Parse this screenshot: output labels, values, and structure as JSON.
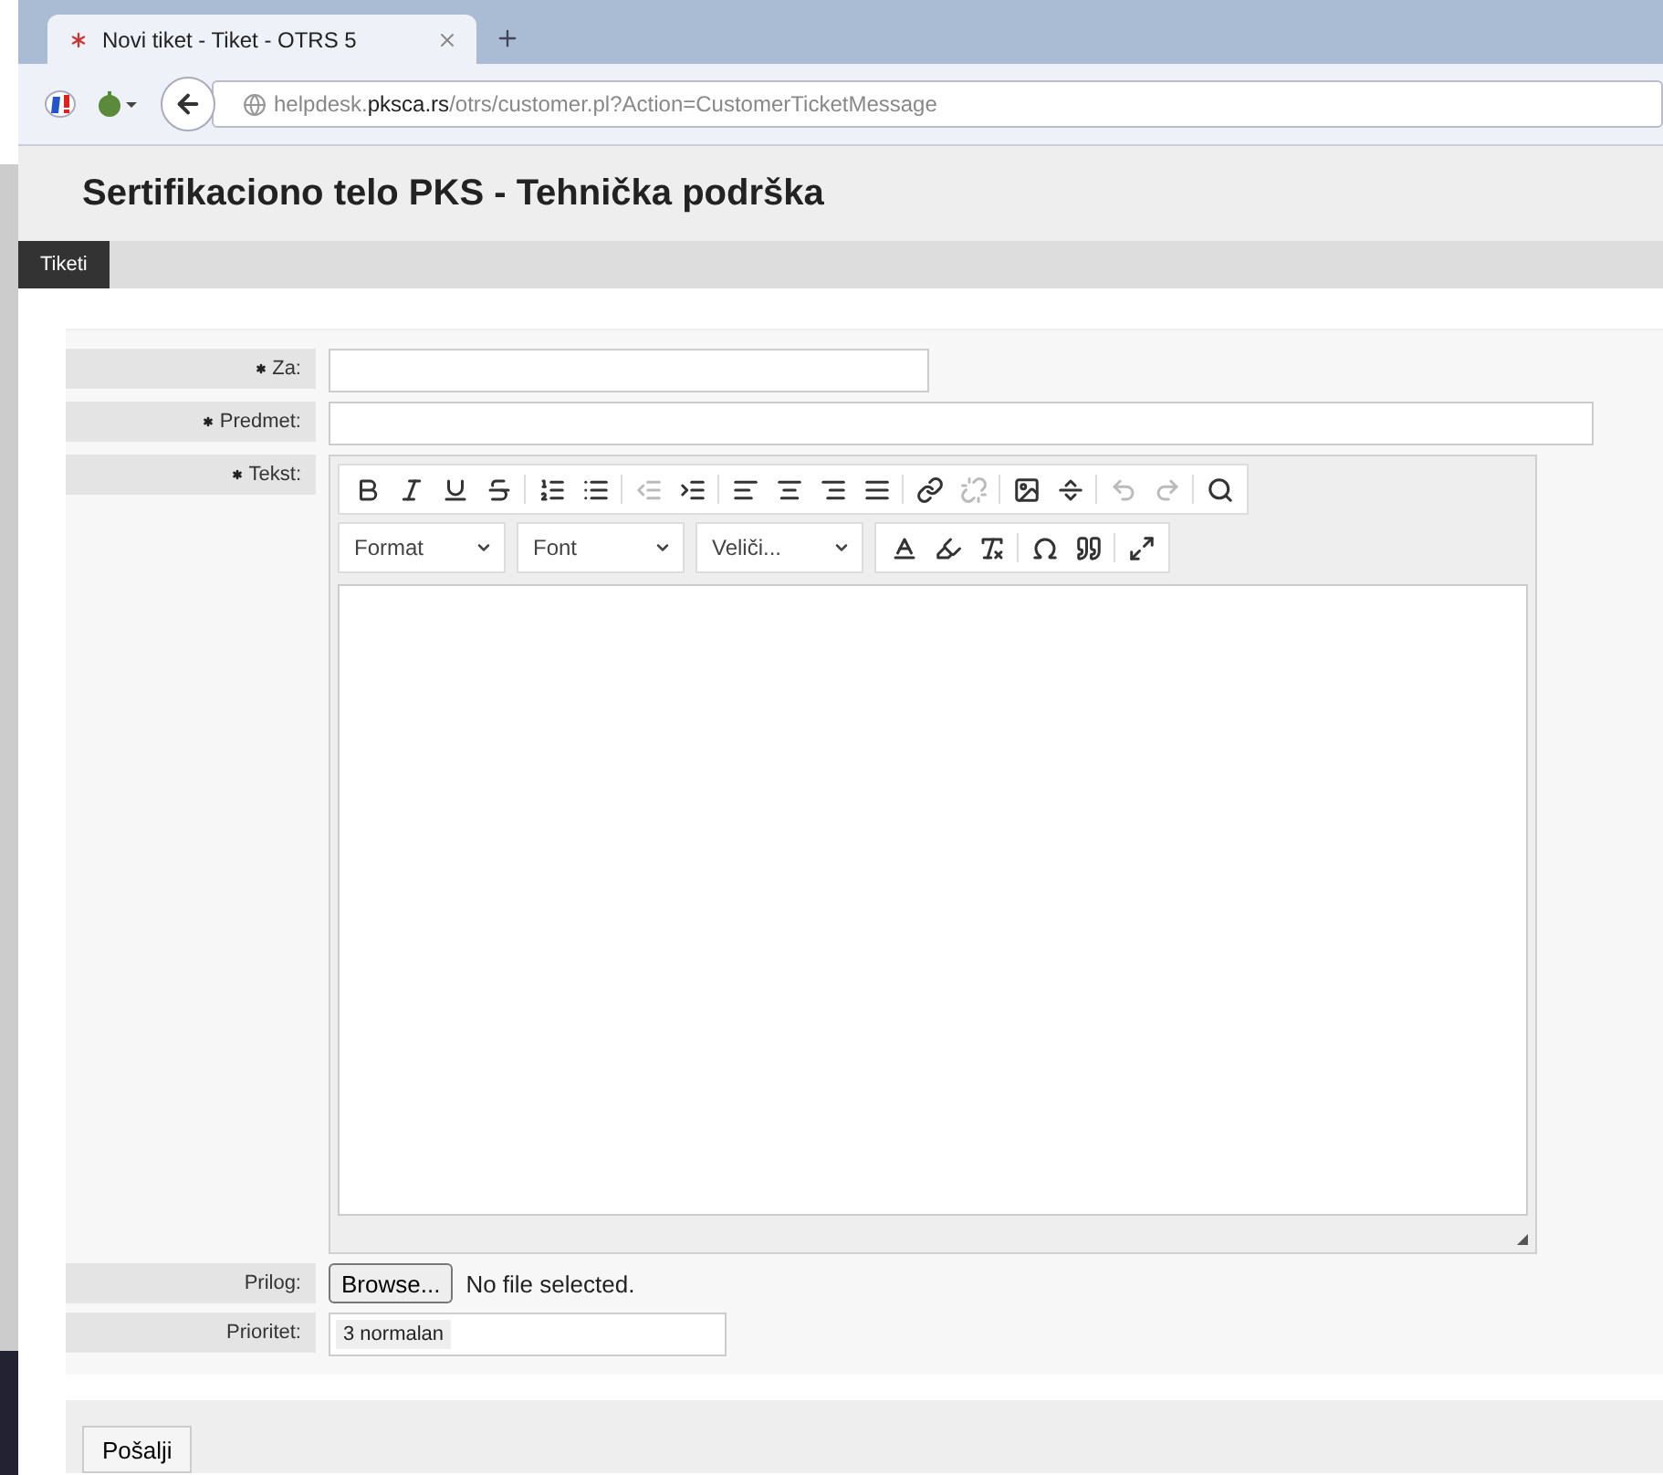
{
  "browser": {
    "tab_title": "Novi tiket - Tiket - OTRS 5",
    "url": "helpdesk.**pksca.rs**/otrs/customer.pl?Action=CustomerTicketMessage"
  },
  "header": {
    "title": "Sertifikaciono telo PKS - Tehnička podrška"
  },
  "nav": [
    {
      "label": "Tiketi",
      "selected": true
    }
  ],
  "form": {
    "fields": [
      {
        "label": "Za:",
        "required": true,
        "kind": "short"
      },
      {
        "label": "Predmet:",
        "required": true,
        "kind": "long"
      },
      {
        "label": "Tekst:",
        "required": true,
        "kind": "editor"
      }
    ],
    "editor": {
      "row_1": [
        [
          {
            "kind": "bold",
            "disabled": false
          },
          {
            "kind": "italic",
            "disabled": false
          },
          {
            "kind": "underline",
            "disabled": false
          },
          {
            "kind": "strike",
            "disabled": false
          }
        ],
        [
          {
            "kind": "numbered",
            "disabled": false
          },
          {
            "kind": "bulleted",
            "disabled": false
          }
        ],
        [
          {
            "kind": "outdent",
            "disabled": true
          },
          {
            "kind": "indent",
            "disabled": false
          }
        ],
        [
          {
            "kind": "align-left",
            "disabled": false
          },
          {
            "kind": "align-center",
            "disabled": false
          },
          {
            "kind": "align-right",
            "disabled": false
          },
          {
            "kind": "justify",
            "disabled": false
          }
        ],
        [
          {
            "kind": "link",
            "disabled": false
          },
          {
            "kind": "unlink",
            "disabled": true
          }
        ],
        [
          {
            "kind": "image",
            "disabled": false
          },
          {
            "kind": "rule",
            "disabled": false
          }
        ],
        [
          {
            "kind": "undo",
            "disabled": true
          },
          {
            "kind": "redo",
            "disabled": true
          }
        ],
        [
          {
            "kind": "find",
            "disabled": false
          }
        ]
      ],
      "dropdowns": [
        "Format",
        "Font",
        "Veliči..."
      ],
      "row_2": [
        [
          {
            "kind": "text-color",
            "disabled": false
          },
          {
            "kind": "bg-color",
            "disabled": false
          },
          {
            "kind": "clear-format",
            "disabled": false
          }
        ],
        [
          {
            "kind": "omega",
            "disabled": false
          },
          {
            "kind": "quote",
            "disabled": false
          }
        ],
        [
          {
            "kind": "maximize",
            "disabled": false
          }
        ]
      ]
    },
    "attachment": {
      "label": "Prilog:",
      "button": "Browse...",
      "status": "No file selected."
    },
    "priority": {
      "label": "Prioritet:",
      "value": "3 normalan"
    }
  },
  "submit": "Pošalji"
}
